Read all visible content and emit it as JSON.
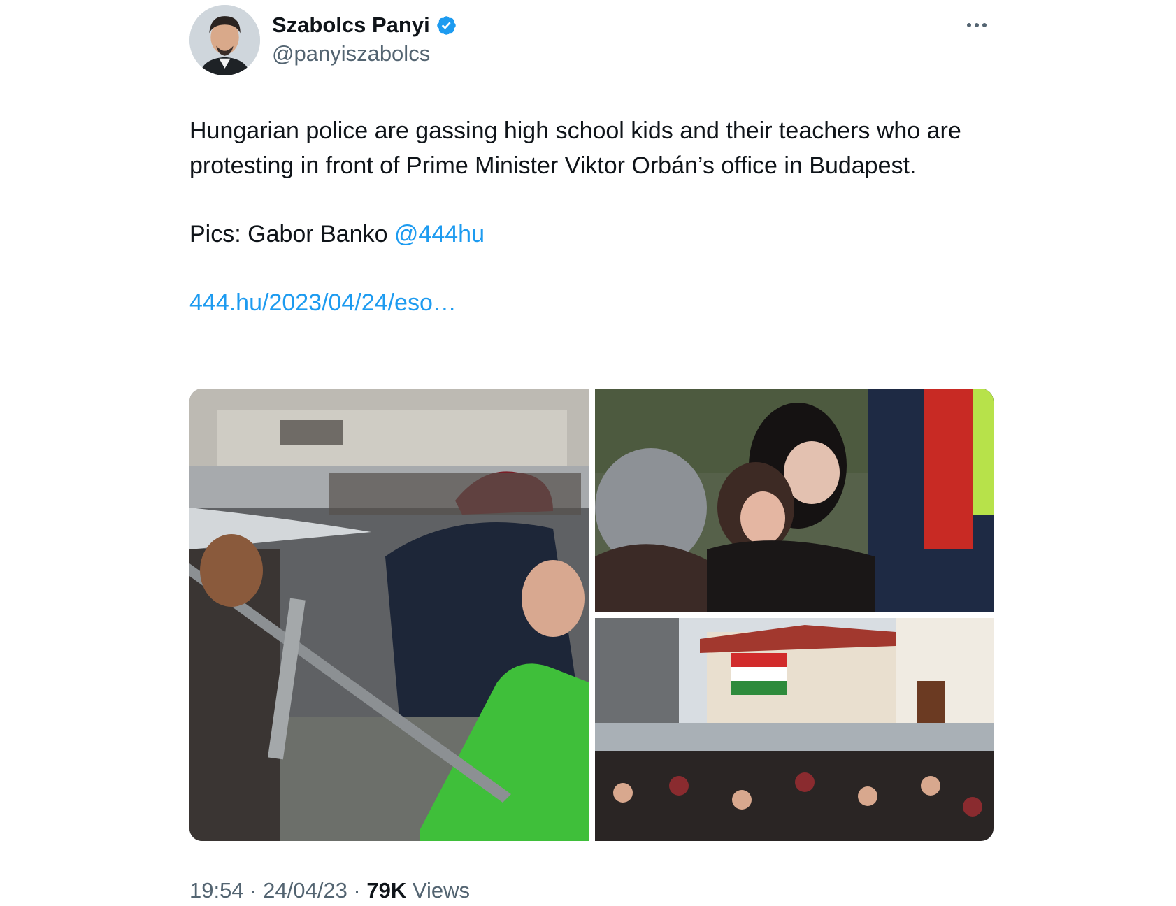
{
  "author": {
    "name": "Szabolcs Panyi",
    "handle": "@panyiszabolcs",
    "verified_color": "#1d9bf0"
  },
  "tweet": {
    "text_line1": "Hungarian police are gassing high school kids and their teachers who are protesting in front of Prime Minister Viktor Orbán’s office in Budapest.",
    "credit_prefix": "Pics: Gabor Banko ",
    "credit_mention": "@444hu",
    "url": "444.hu/2023/04/24/eso…"
  },
  "meta": {
    "time": "19:54",
    "separator": " · ",
    "date": "24/04/23",
    "views_count": "79K",
    "views_label": " Views"
  },
  "icons": {
    "more": "more-horizontal-icon",
    "verified": "verified-badge-icon"
  },
  "colors": {
    "link": "#1d9bf0",
    "secondary_text": "#536471",
    "primary_text": "#0f1419"
  }
}
